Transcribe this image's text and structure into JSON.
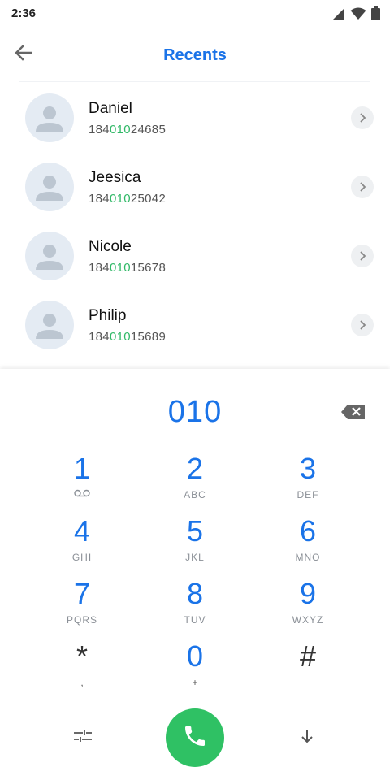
{
  "status_bar": {
    "time": "2:36"
  },
  "header": {
    "title": "Recents"
  },
  "contacts": [
    {
      "name": "Daniel",
      "number_prefix": "184",
      "number_match": "010",
      "number_suffix": "24685"
    },
    {
      "name": "Jeesica",
      "number_prefix": "184",
      "number_match": "010",
      "number_suffix": "25042"
    },
    {
      "name": "Nicole",
      "number_prefix": "184",
      "number_match": "010",
      "number_suffix": "15678"
    },
    {
      "name": "Philip",
      "number_prefix": "184",
      "number_match": "010",
      "number_suffix": "15689"
    }
  ],
  "dialer": {
    "number": "010",
    "keys": [
      {
        "digit": "1",
        "letters": ""
      },
      {
        "digit": "2",
        "letters": "ABC"
      },
      {
        "digit": "3",
        "letters": "DEF"
      },
      {
        "digit": "4",
        "letters": "GHI"
      },
      {
        "digit": "5",
        "letters": "JKL"
      },
      {
        "digit": "6",
        "letters": "MNO"
      },
      {
        "digit": "7",
        "letters": "PQRS"
      },
      {
        "digit": "8",
        "letters": "TUV"
      },
      {
        "digit": "9",
        "letters": "WXYZ"
      },
      {
        "digit": "*",
        "letters": ","
      },
      {
        "digit": "0",
        "letters": "+"
      },
      {
        "digit": "#",
        "letters": ""
      }
    ]
  },
  "colors": {
    "accent": "#1a73e8",
    "match_highlight": "#2fb866",
    "call_button": "#2fc164",
    "avatar_bg": "#e4ebf3"
  },
  "icons": {
    "back": "arrow-left-icon",
    "voicemail": "voicemail-icon",
    "backspace": "backspace-icon",
    "options": "dialpad-options-icon",
    "call": "phone-icon",
    "hide_dialpad": "arrow-down-icon"
  }
}
